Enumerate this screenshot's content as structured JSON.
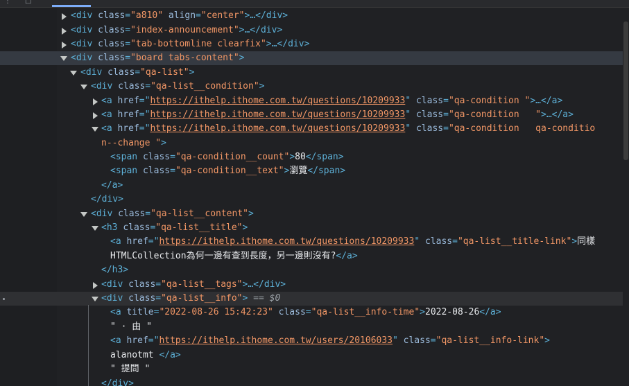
{
  "toolbar": {
    "glyph_a": "⋮",
    "glyph_b": "□"
  },
  "dom_tree": {
    "l0": {
      "open": "<div",
      "a1": "class",
      "v1": "\"a810\"",
      "a2": "align",
      "v2": "\"center\"",
      "rest": ">…</div>"
    },
    "l1": {
      "open": "<div",
      "a1": "class",
      "v1": "\"index-announcement\"",
      "rest": ">…</div>"
    },
    "l2": {
      "open": "<div",
      "a1": "class",
      "v1": "\"tab-bottomline clearfix\"",
      "rest": ">…</div>"
    },
    "l3": {
      "open": "<div",
      "a1": "class",
      "v1": "\"board tabs-content\"",
      "rest": ">"
    },
    "l4": {
      "open": "<div",
      "a1": "class",
      "v1": "\"qa-list\"",
      "rest": ">"
    },
    "l5": {
      "open": "<div",
      "a1": "class",
      "v1": "\"qa-list__condition\"",
      "rest": ">"
    },
    "l6": {
      "open": "<a",
      "a1": "href",
      "url": "https://ithelp.ithome.com.tw/questions/10209933",
      "a2": "class",
      "v2": "\"qa-condition \"",
      "rest": ">…</a>"
    },
    "l7": {
      "open": "<a",
      "a1": "href",
      "url": "https://ithelp.ithome.com.tw/questions/10209933",
      "a2": "class",
      "v2": "\"qa-condition   \"",
      "rest": ">…</a>"
    },
    "l8": {
      "open": "<a",
      "a1": "href",
      "url": "https://ithelp.ithome.com.tw/questions/10209933",
      "a2": "class",
      "v2": "\"qa-condition   qa-conditio"
    },
    "l9": {
      "v": "n--change \"",
      "rest": ">"
    },
    "l10": {
      "open": "<span",
      "a1": "class",
      "v1": "\"qa-condition__count\"",
      "gt": ">",
      "text": "80",
      "close": "</span>"
    },
    "l11": {
      "open": "<span",
      "a1": "class",
      "v1": "\"qa-condition__text\"",
      "gt": ">",
      "text": "瀏覽",
      "close": "</span>"
    },
    "l12": {
      "close": "</a>"
    },
    "l13": {
      "close": "</div>"
    },
    "l14": {
      "open": "<div",
      "a1": "class",
      "v1": "\"qa-list__content\"",
      "rest": ">"
    },
    "l15": {
      "open": "<h3",
      "a1": "class",
      "v1": "\"qa-list__title\"",
      "rest": ">"
    },
    "l16": {
      "open": "<a",
      "a1": "href",
      "url": "https://ithelp.ithome.com.tw/questions/10209933",
      "a2": "class",
      "v2": "\"qa-list__title-link\"",
      "gt": ">",
      "text": "同樣"
    },
    "l17": {
      "text": "HTMLCollection為何一邊有查到長度，另一邊則沒有?",
      "close": "</a>"
    },
    "l18": {
      "close": "</h3>"
    },
    "l19": {
      "open": "<div",
      "a1": "class",
      "v1": "\"qa-list__tags\"",
      "rest": ">…</div>"
    },
    "l20": {
      "open": "<div",
      "a1": "class",
      "v1": "\"qa-list__info\"",
      "rest": ">",
      "marker": "== $0"
    },
    "l21": {
      "open": "<a",
      "a1": "title",
      "v1": "\"2022-08-26 15:42:23\"",
      "a2": "class",
      "v2": "\"qa-list__info-time\"",
      "gt": ">",
      "text": "2022-08-26",
      "close": "</a>"
    },
    "l22": {
      "text": "\" · 由 \""
    },
    "l23": {
      "open": "<a",
      "a1": "href",
      "url": "https://ithelp.ithome.com.tw/users/20106033",
      "a2": "class",
      "v2": "\"qa-list__info-link\"",
      "rest": ">"
    },
    "l24": {
      "text": "alanotmt ",
      "close": "</a>"
    },
    "l25": {
      "text": "\" 提問 \""
    },
    "l26": {
      "close": "</div>"
    }
  }
}
